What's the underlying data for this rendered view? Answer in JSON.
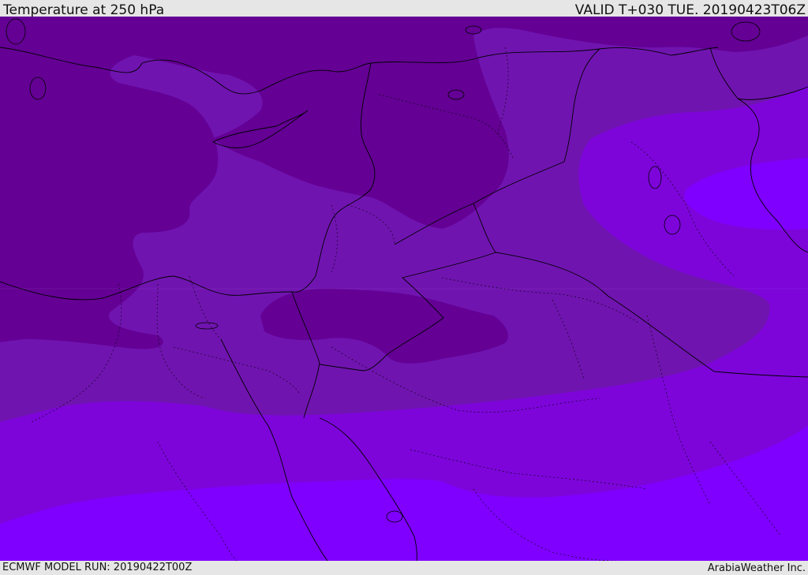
{
  "header": {
    "title": "Temperature at 250 hPa",
    "valid_time": "VALID T+030 TUE. 20190423T06Z"
  },
  "footer": {
    "model_run": "ECMWF MODEL RUN: 20190422T00Z",
    "credit": "ArabiaWeather Inc."
  },
  "map": {
    "region": "Eastern Mediterranean / Levant / Arabia",
    "colors": {
      "coldest": "#640094",
      "cold": "#7014b0",
      "mid": "#7d05da",
      "warm": "#7f00ff",
      "border": "#000000"
    }
  }
}
